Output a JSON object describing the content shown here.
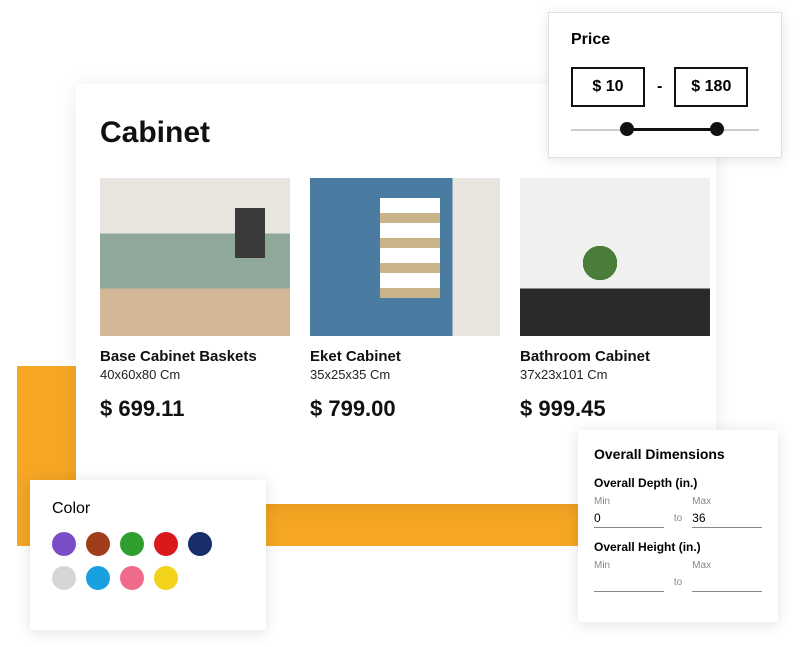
{
  "page_title": "Cabinet",
  "products": [
    {
      "name": "Base Cabinet Baskets",
      "dims": "40x60x80 Cm",
      "price": "$ 699.11"
    },
    {
      "name": "Eket Cabinet",
      "dims": "35x25x35 Cm",
      "price": "$ 799.00"
    },
    {
      "name": "Bathroom Cabinet",
      "dims": "37x23x101 Cm",
      "price": "$ 999.45"
    }
  ],
  "price_filter": {
    "title": "Price",
    "min": "$ 10",
    "max": "$ 180",
    "dash": "-"
  },
  "color_filter": {
    "title": "Color",
    "swatches": [
      "#7b4ec9",
      "#a03d1a",
      "#2e9e2e",
      "#d91a1a",
      "#1a2e6e",
      "#d6d6d6",
      "#1aa0e0",
      "#f06a8a",
      "#f2d21a"
    ]
  },
  "dims_filter": {
    "title": "Overall Dimensions",
    "depth_label": "Overall Depth (in.)",
    "height_label": "Overall Height (in.)",
    "min_label": "Min",
    "max_label": "Max",
    "to_label": "to",
    "depth_min": "0",
    "depth_max": "36",
    "height_min": "",
    "height_max": ""
  }
}
